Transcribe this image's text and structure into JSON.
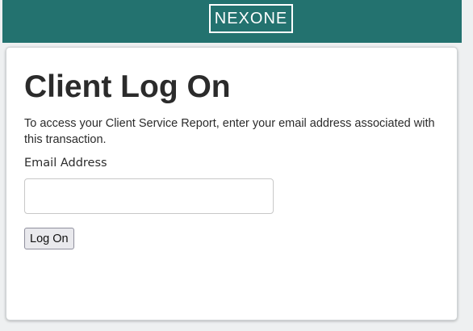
{
  "header": {
    "logo_text": "NEXONE"
  },
  "main": {
    "title": "Client Log On",
    "instructions": "To access your Client Service Report, enter your email address associated with this transaction.",
    "email_label": "Email Address",
    "email_value": "",
    "email_placeholder": "",
    "logon_label": "Log On"
  },
  "colors": {
    "brand": "#23726f",
    "background": "#eef0f1",
    "card": "#ffffff",
    "text": "#2b2b2b"
  }
}
